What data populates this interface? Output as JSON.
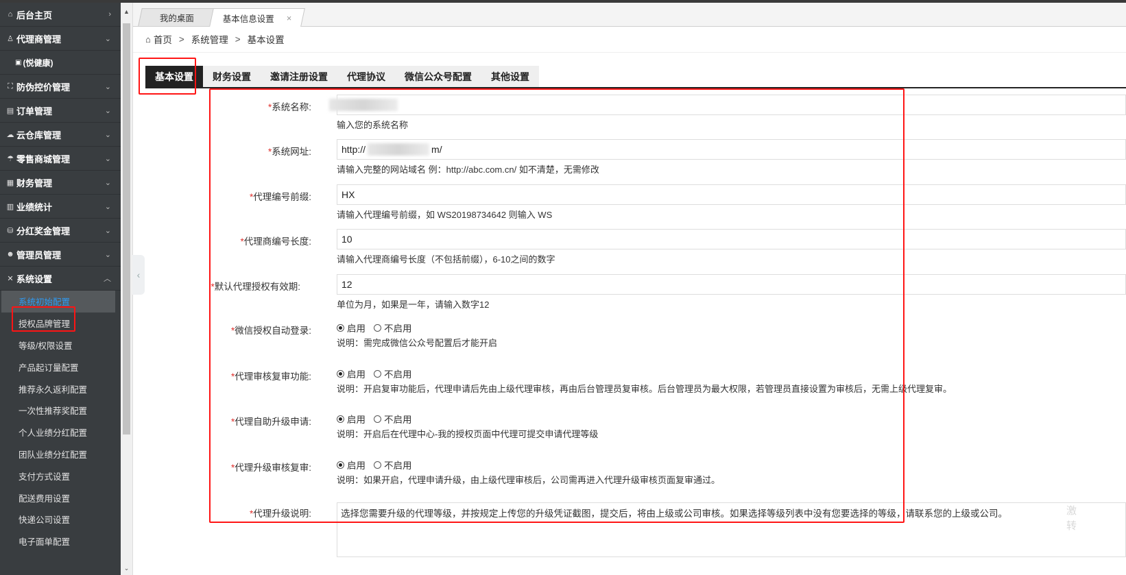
{
  "sidebar": {
    "items": [
      {
        "icon": "home-icon",
        "glyph": "⌂",
        "label": "后台主页",
        "arrow": "›"
      },
      {
        "icon": "user-icon",
        "glyph": "♙",
        "label": "代理商管理",
        "arrow": "⌄"
      }
    ],
    "sub_brand": {
      "glyph": "▣",
      "label": "(悦健康)"
    },
    "items2": [
      {
        "icon": "shield-icon",
        "glyph": "⛶",
        "label": "防伪控价管理",
        "arrow": "⌄"
      },
      {
        "icon": "document-icon",
        "glyph": "▤",
        "label": "订单管理",
        "arrow": "⌄"
      },
      {
        "icon": "cloud-icon",
        "glyph": "☁",
        "label": "云仓库管理",
        "arrow": "⌄"
      },
      {
        "icon": "umbrella-icon",
        "glyph": "☂",
        "label": "零售商城管理",
        "arrow": "⌄"
      },
      {
        "icon": "finance-icon",
        "glyph": "▦",
        "label": "财务管理",
        "arrow": "⌄"
      },
      {
        "icon": "bar-chart-icon",
        "glyph": "▥",
        "label": "业绩统计",
        "arrow": "⌄"
      },
      {
        "icon": "database-icon",
        "glyph": "⛁",
        "label": "分红奖金管理",
        "arrow": "⌄"
      },
      {
        "icon": "admin-icon",
        "glyph": "☻",
        "label": "管理员管理",
        "arrow": "⌄"
      },
      {
        "icon": "tools-icon",
        "glyph": "✕",
        "label": "系统设置",
        "arrow": "︿"
      }
    ],
    "sub_items": [
      "系统初始配置",
      "授权品牌管理",
      "等级/权限设置",
      "产品起订量配置",
      "推荐永久返利配置",
      "一次性推荐奖配置",
      "个人业绩分红配置",
      "团队业绩分红配置",
      "支付方式设置",
      "配送费用设置",
      "快递公司设置",
      "电子面单配置"
    ]
  },
  "page_tabs": {
    "desktop": "我的桌面",
    "current": "基本信息设置",
    "close": "×"
  },
  "breadcrumb": {
    "home": "首页",
    "sep": ">",
    "system": "系统管理",
    "current": "基本设置"
  },
  "setting_tabs": [
    "基本设置",
    "财务设置",
    "邀请注册设置",
    "代理协议",
    "微信公众号配置",
    "其他设置"
  ],
  "form": {
    "system_name": {
      "label": "系统名称:",
      "value": "",
      "hint": "输入您的系统名称"
    },
    "system_url": {
      "label": "系统网址:",
      "value_prefix": "http://",
      "value_suffix": "m/",
      "hint": "请输入完整的网站域名 例：http://abc.com.cn/ 如不清楚，无需修改"
    },
    "agent_prefix": {
      "label": "代理编号前缀:",
      "value": "HX",
      "hint": "请输入代理编号前缀，如 WS20198734642 则输入 WS"
    },
    "agent_length": {
      "label": "代理商编号长度:",
      "value": "10",
      "hint": "请输入代理商编号长度（不包括前缀），6-10之间的数字"
    },
    "auth_period": {
      "label": "默认代理授权有效期:",
      "value": "12",
      "hint": "单位为月，如果是一年，请输入数字12"
    },
    "wechat_login": {
      "label": "微信授权自动登录:",
      "on": "启用",
      "off": "不启用",
      "selected": "on",
      "hint": "说明：需完成微信公众号配置后才能开启"
    },
    "review": {
      "label": "代理审核复审功能:",
      "on": "启用",
      "off": "不启用",
      "selected": "on",
      "hint": "说明：开启复审功能后，代理申请后先由上级代理审核，再由后台管理员复审核。后台管理员为最大权限，若管理员直接设置为审核后，无需上级代理复审。"
    },
    "self_upgrade": {
      "label": "代理自助升级申请:",
      "on": "启用",
      "off": "不启用",
      "selected": "on",
      "hint": "说明：开启后在代理中心-我的授权页面中代理可提交申请代理等级"
    },
    "upgrade_review": {
      "label": "代理升级审核复审:",
      "on": "启用",
      "off": "不启用",
      "selected": "on",
      "hint": "说明：如果开启，代理申请升级，由上级代理审核后，公司需再进入代理升级审核页面复审通过。"
    },
    "upgrade_desc": {
      "label": "代理升级说明:",
      "value": "选择您需要升级的代理等级，并按规定上传您的升级凭证截图，提交后，将由上级或公司审核。如果选择等级列表中没有您要选择的等级，请联系您的上级或公司。"
    }
  },
  "required_mark": "*",
  "watermark": [
    "激",
    "转"
  ],
  "colors": {
    "sidebar": "#393d40",
    "active_link": "#2f9bf3",
    "required": "#e0312d",
    "highlight_box": "#ff1414",
    "active_tab": "#222222"
  }
}
